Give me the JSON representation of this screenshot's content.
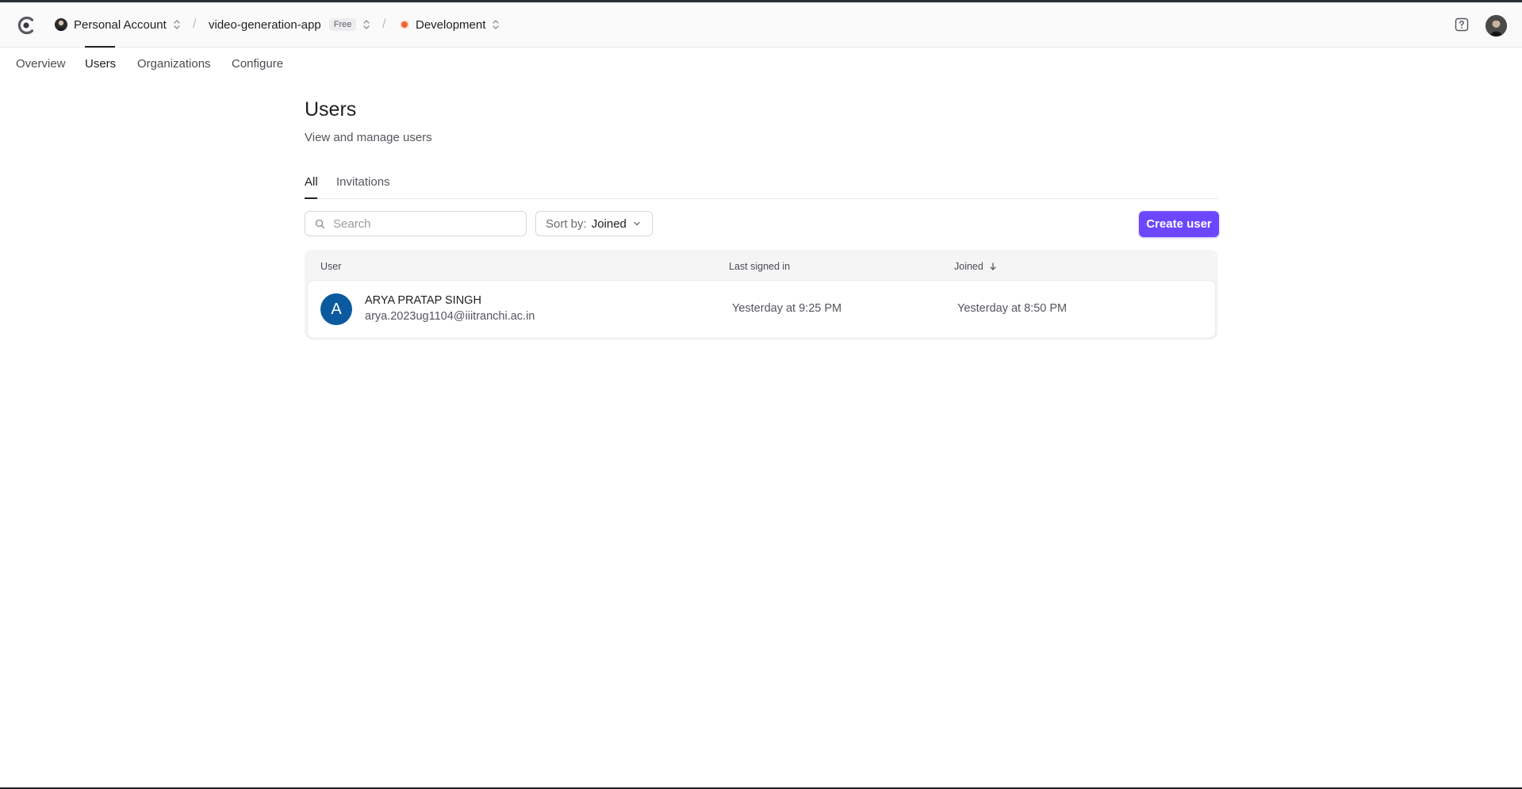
{
  "topbar": {
    "account": {
      "label": "Personal Account"
    },
    "app": {
      "label": "video-generation-app",
      "badge": "Free"
    },
    "instance": {
      "label": "Development"
    },
    "separator": "/"
  },
  "subnav": {
    "tabs": [
      {
        "label": "Overview"
      },
      {
        "label": "Users"
      },
      {
        "label": "Organizations"
      },
      {
        "label": "Configure"
      }
    ],
    "active": "Users"
  },
  "main": {
    "title": "Users",
    "subtitle": "View and manage users",
    "tabs": [
      {
        "label": "All"
      },
      {
        "label": "Invitations"
      }
    ],
    "search": {
      "placeholder": "Search",
      "value": ""
    },
    "sort": {
      "label": "Sort by:",
      "value": "Joined"
    },
    "create_button": "Create user"
  },
  "table": {
    "columns": [
      "User",
      "Last signed in",
      "Joined"
    ],
    "rows": [
      {
        "avatar_letter": "A",
        "name": "ARYA PRATAP SINGH",
        "email": "arya.2023ug1104@iiitranchi.ac.in",
        "last_signed_in": "Yesterday at 9:25 PM",
        "joined": "Yesterday at 8:50 PM"
      }
    ]
  },
  "colors": {
    "accent": "#6c47ff",
    "avatar": "#0b5aa0",
    "env_dot": "#f0632f"
  }
}
